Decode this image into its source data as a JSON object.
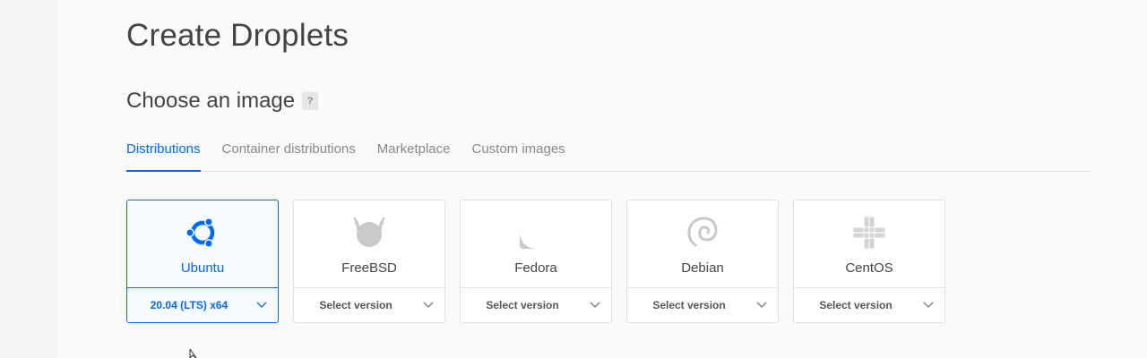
{
  "page": {
    "title": "Create Droplets"
  },
  "section": {
    "title": "Choose an image",
    "help": "?"
  },
  "tabs": [
    {
      "label": "Distributions",
      "active": true
    },
    {
      "label": "Container distributions"
    },
    {
      "label": "Marketplace"
    },
    {
      "label": "Custom images"
    }
  ],
  "images": [
    {
      "name": "Ubuntu",
      "version": "20.04 (LTS) x64",
      "icon": "ubuntu-icon",
      "selected": true
    },
    {
      "name": "FreeBSD",
      "version": "Select version",
      "icon": "freebsd-icon"
    },
    {
      "name": "Fedora",
      "version": "Select version",
      "icon": "fedora-icon"
    },
    {
      "name": "Debian",
      "version": "Select version",
      "icon": "debian-icon"
    },
    {
      "name": "CentOS",
      "version": "Select version",
      "icon": "centos-icon"
    }
  ],
  "colors": {
    "accent": "#0069ff",
    "logo_gray": "#c9c9c9"
  }
}
